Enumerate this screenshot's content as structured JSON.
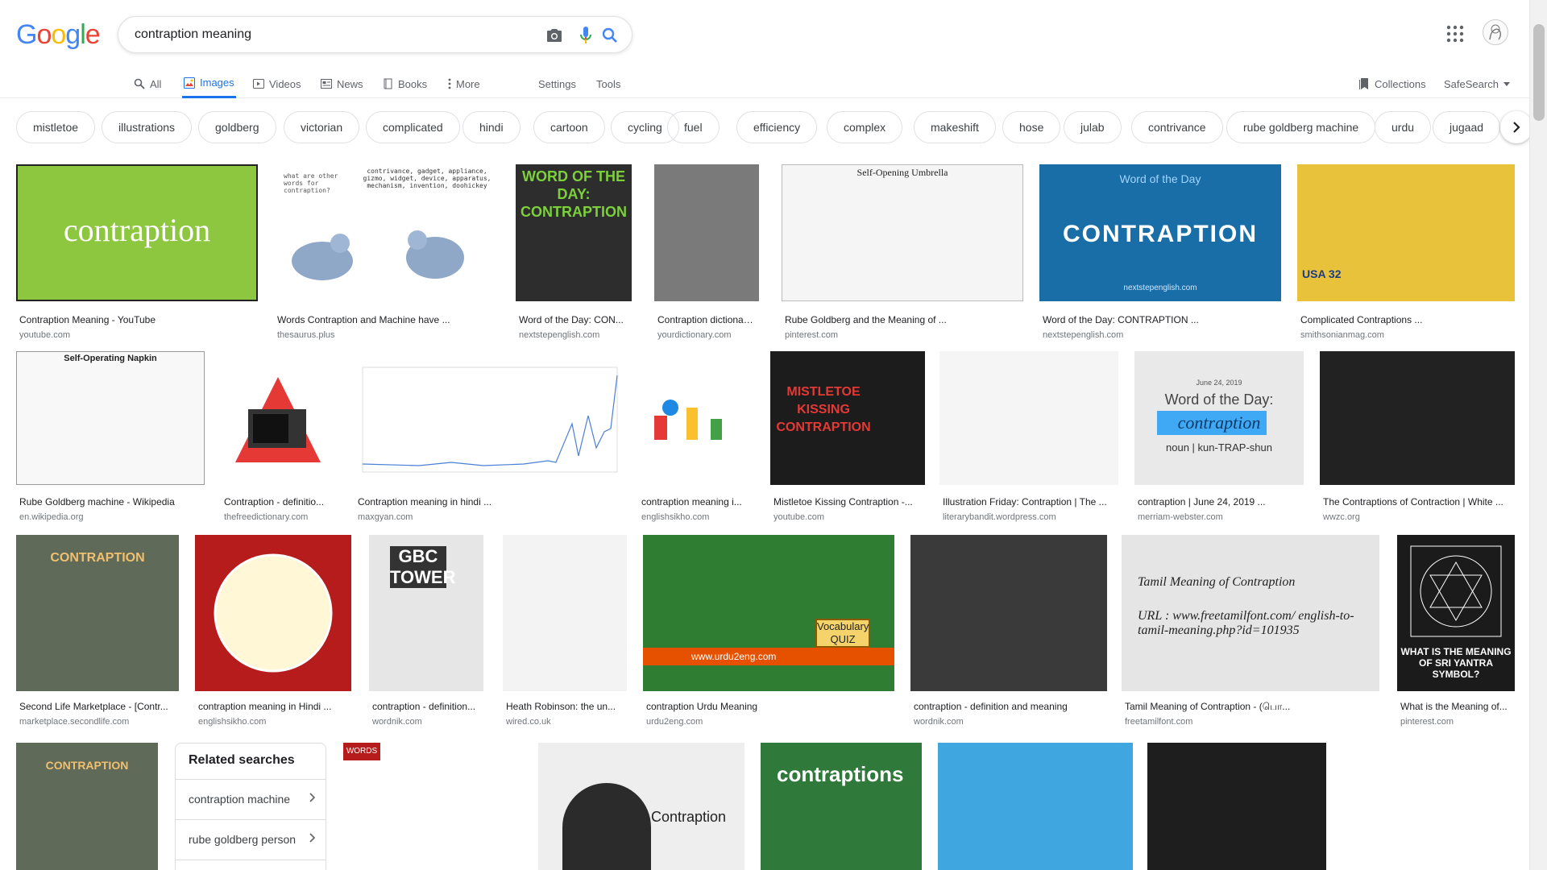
{
  "search": {
    "query": "contraption meaning"
  },
  "logo": {
    "G": "G",
    "o1": "o",
    "o2": "o",
    "g": "g",
    "l": "l",
    "e": "e"
  },
  "tabs": [
    {
      "label": "All",
      "icon": "search-icon"
    },
    {
      "label": "Images",
      "icon": "image-icon"
    },
    {
      "label": "Videos",
      "icon": "video-icon"
    },
    {
      "label": "News",
      "icon": "news-icon"
    },
    {
      "label": "Books",
      "icon": "book-icon"
    },
    {
      "label": "More",
      "icon": "more-icon"
    }
  ],
  "tools": {
    "settings": "Settings",
    "tools": "Tools",
    "collections": "Collections",
    "safesearch": "SafeSearch"
  },
  "chips": [
    "mistletoe",
    "illustrations",
    "goldberg",
    "victorian",
    "complicated",
    "hindi",
    "cartoon",
    "cycling",
    "fuel",
    "efficiency",
    "complex",
    "makeshift",
    "hose",
    "julab",
    "contrivance",
    "rube goldberg machine",
    "urdu",
    "jugaad"
  ],
  "results": [
    {
      "caption": "Contraption Meaning - YouTube",
      "domain": "youtube.com",
      "overlay": "contraption",
      "color": "#8dc63f"
    },
    {
      "caption": "Words Contraption and Machine have ...",
      "domain": "thesaurus.plus",
      "overlay": "contrivance, gadget, appliance, gizmo, widget, device, apparatus, mechanism, invention, doohickey",
      "overlay2": "what are other words for contraption?",
      "color": "#ffffff"
    },
    {
      "caption": "Word of the Day: CON...",
      "domain": "nextstepenglish.com",
      "overlay": "WORD OF THE DAY: CONTRAPTION",
      "color": "#2d2d2d"
    },
    {
      "caption": "Contraption dictionary ...",
      "domain": "yourdictionary.com",
      "color": "#7a7a7a"
    },
    {
      "caption": "Rube Goldberg and the Meaning of ...",
      "domain": "pinterest.com",
      "overlay": "Self-Opening Umbrella",
      "color": "#f5f5f5"
    },
    {
      "caption": "Word of the Day: CONTRAPTION ...",
      "domain": "nextstepenglish.com",
      "overlay": "CONTRAPTION",
      "overlay2": "Word of the Day",
      "overlay3": "nextstepenglish.com",
      "color": "#1a6ea8"
    },
    {
      "caption": "Complicated Contraptions ...",
      "domain": "smithsonianmag.com",
      "overlay": "USA 32",
      "color": "#e8c23a"
    },
    {
      "caption": "Rube Goldberg machine - Wikipedia",
      "domain": "en.wikipedia.org",
      "overlay": "Self-Operating Napkin",
      "color": "#f8f8f8"
    },
    {
      "caption": "Contraption - definitio...",
      "domain": "thefreedictionary.com",
      "color": "#ffffff"
    },
    {
      "caption": "Contraption meaning in hindi ...",
      "domain": "maxgyan.com",
      "color": "#ffffff"
    },
    {
      "caption": "contraption meaning i...",
      "domain": "englishsikho.com",
      "color": "#ffffff"
    },
    {
      "caption": "Mistletoe Kissing Contraption -...",
      "domain": "youtube.com",
      "overlay": "MISTLETOE KISSING CONTRAPTION",
      "color": "#1c1c1c"
    },
    {
      "caption": "Illustration Friday: Contraption | The ...",
      "domain": "literarybandit.wordpress.com",
      "color": "#f5f5f5"
    },
    {
      "caption": "contraption | June 24, 2019 ...",
      "domain": "merriam-webster.com",
      "overlay": "contraption",
      "overlay2": "Word of the Day:",
      "overlay3": "noun | kun-TRAP-shun",
      "overlay4": "June 24, 2019",
      "color": "#e9e9e9"
    },
    {
      "caption": "The Contraptions of Contraction | White ...",
      "domain": "wwzc.org",
      "color": "#222222"
    },
    {
      "caption": "Second Life Marketplace - [Contr...",
      "domain": "marketplace.secondlife.com",
      "overlay": "CONTRAPTION",
      "color": "#5f6a58"
    },
    {
      "caption": "contraption meaning in Hindi ...",
      "domain": "englishsikho.com",
      "color": "#b71c1c"
    },
    {
      "caption": "contraption - definition...",
      "domain": "wordnik.com",
      "overlay": "GBC TOWER",
      "color": "#e6e6e6"
    },
    {
      "caption": "Heath Robinson: the un...",
      "domain": "wired.co.uk",
      "color": "#f3f3f3"
    },
    {
      "caption": "contraption Urdu Meaning",
      "domain": "urdu2eng.com",
      "overlay": "Vocabulary QUIZ",
      "overlay2": "www.urdu2eng.com",
      "color": "#2e7d32"
    },
    {
      "caption": "contraption - definition and meaning",
      "domain": "wordnik.com",
      "color": "#3a3a3a"
    },
    {
      "caption": "Tamil Meaning of Contraption - (பொ...",
      "domain": "freetamilfont.com",
      "overlay": "Tamil Meaning of Contraption",
      "overlay2": "URL : www.freetamilfont.com/ english-to-tamil-meaning.php?id=101935",
      "color": "#e5e5e5"
    },
    {
      "caption": "What is the Meaning of...",
      "domain": "pinterest.com",
      "overlay": "WHAT IS THE MEANING OF SRI YANTRA SYMBOL?",
      "color": "#1b1b1b"
    }
  ],
  "row4": [
    {
      "overlay": "CONTRAPTION",
      "color": "#5f6a58"
    },
    {
      "overlay": "WORDS",
      "color": "#ffffff"
    },
    {
      "overlay": "Contraption",
      "color": "#eeeeee"
    },
    {
      "overlay": "contraptions",
      "color": "#2f7a3a"
    },
    {
      "color": "#3fa6e0"
    },
    {
      "color": "#1e1e1e"
    },
    {
      "color": "#ffffff"
    }
  ],
  "related": {
    "title": "Related searches",
    "items": [
      "contraption machine",
      "rube goldberg person"
    ]
  }
}
